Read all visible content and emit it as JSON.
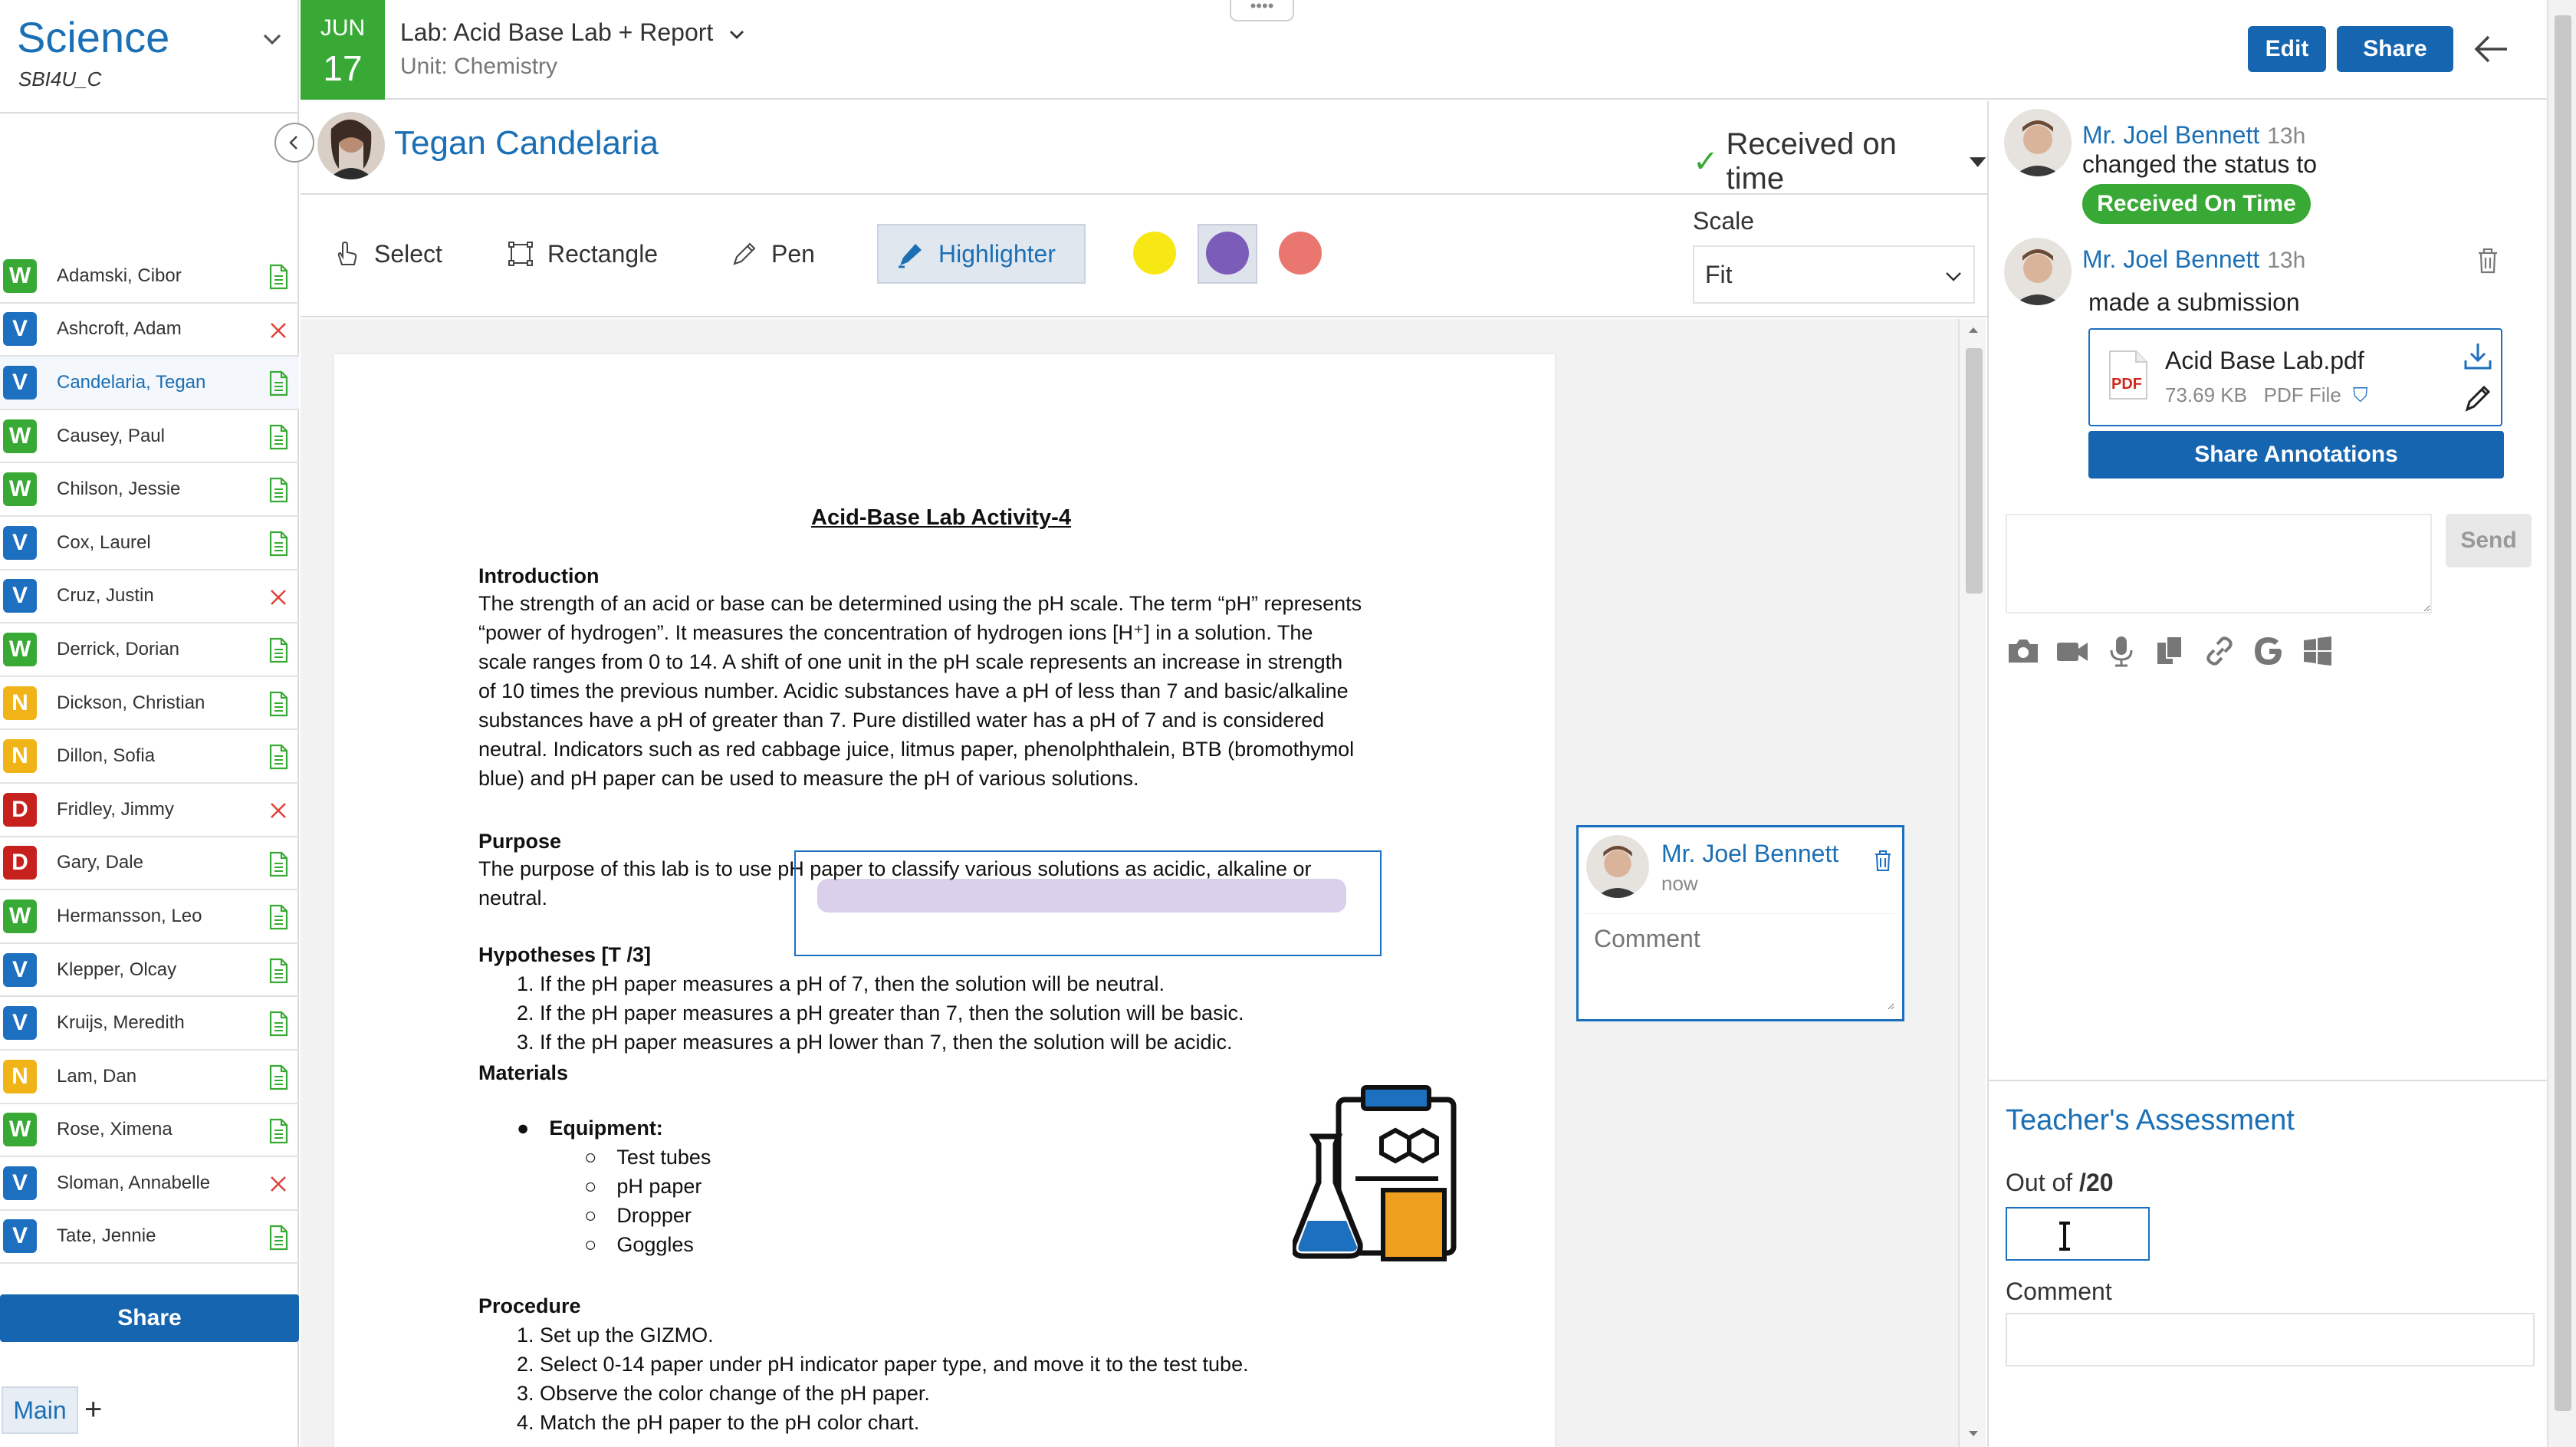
{
  "course": {
    "title": "Science",
    "code": "SBI4U_C"
  },
  "students": [
    {
      "badge": "W",
      "name": "Adamski, Cibor",
      "status": "submitted"
    },
    {
      "badge": "V",
      "name": "Ashcroft, Adam",
      "status": "missing"
    },
    {
      "badge": "V",
      "name": "Candelaria, Tegan",
      "status": "submitted",
      "active": true
    },
    {
      "badge": "W",
      "name": "Causey, Paul",
      "status": "submitted"
    },
    {
      "badge": "W",
      "name": "Chilson, Jessie",
      "status": "submitted"
    },
    {
      "badge": "V",
      "name": "Cox, Laurel",
      "status": "submitted"
    },
    {
      "badge": "V",
      "name": "Cruz, Justin",
      "status": "missing"
    },
    {
      "badge": "W",
      "name": "Derrick, Dorian",
      "status": "submitted"
    },
    {
      "badge": "N",
      "name": "Dickson, Christian",
      "status": "submitted"
    },
    {
      "badge": "N",
      "name": "Dillon, Sofia",
      "status": "submitted"
    },
    {
      "badge": "D",
      "name": "Fridley, Jimmy",
      "status": "missing"
    },
    {
      "badge": "D",
      "name": "Gary, Dale",
      "status": "submitted"
    },
    {
      "badge": "W",
      "name": "Hermansson, Leo",
      "status": "submitted"
    },
    {
      "badge": "V",
      "name": "Klepper, Olcay",
      "status": "submitted"
    },
    {
      "badge": "V",
      "name": "Kruijs, Meredith",
      "status": "submitted"
    },
    {
      "badge": "N",
      "name": "Lam, Dan",
      "status": "submitted"
    },
    {
      "badge": "W",
      "name": "Rose, Ximena",
      "status": "submitted"
    },
    {
      "badge": "V",
      "name": "Sloman, Annabelle",
      "status": "missing"
    },
    {
      "badge": "V",
      "name": "Tate, Jennie",
      "status": "submitted"
    }
  ],
  "sidebar": {
    "share_label": "Share",
    "tab_main": "Main",
    "tab_add": "+"
  },
  "header": {
    "month": "JUN",
    "day": "17",
    "assignment_title": "Lab: Acid Base Lab + Report",
    "unit": "Unit: Chemistry",
    "drag_handle": "••••",
    "edit_label": "Edit",
    "share_label": "Share"
  },
  "student_view": {
    "name": "Tegan Candelaria",
    "status": "Received on time"
  },
  "toolbar": {
    "select": "Select",
    "rectangle": "Rectangle",
    "pen": "Pen",
    "highlighter": "Highlighter",
    "scale_label": "Scale",
    "scale_value": "Fit",
    "colors": [
      "#f7e815",
      "#7b5cb8",
      "#ea7670"
    ]
  },
  "document": {
    "title": "Acid-Base Lab Activity-4",
    "intro_heading": "Introduction",
    "intro_lines": [
      "The strength of an acid or base can be determined using the pH scale. The term “pH” represents",
      "“power of hydrogen”. It measures the concentration of hydrogen ions [H⁺] in a solution. The",
      "scale ranges from 0 to 14. A shift of one unit in the pH scale represents an increase in strength",
      "of 10 times the previous number. Acidic substances have a pH of less than 7 and basic/alkaline",
      "substances have a pH of greater than 7. Pure distilled water has a pH of 7 and is considered",
      "neutral. Indicators such as red cabbage juice, litmus paper, phenolphthalein, BTB (bromothymol",
      "blue) and pH paper can be used to measure the pH of various solutions."
    ],
    "purpose_heading": "Purpose",
    "purpose_lines": [
      "The purpose of this lab is to use pH paper to classify various solutions as acidic, alkaline or",
      "neutral."
    ],
    "hypotheses_heading": "Hypotheses [T  /3]",
    "hypotheses": [
      "1.   If the pH paper measures a pH of 7, then the solution will be neutral.",
      "2.   If the pH paper measures a pH greater than 7, then the solution will be basic.",
      "3.   If the pH paper measures a pH lower than 7, then the solution will be acidic."
    ],
    "materials_heading": "Materials",
    "equipment_heading": "Equipment:",
    "equipment": [
      "Test tubes",
      "pH paper",
      "Dropper",
      "Goggles"
    ],
    "procedure_heading": "Procedure",
    "procedure": [
      "1.   Set up the GIZMO.",
      "2.   Select 0-14 paper under pH indicator paper type, and move it to the test tube.",
      "3.   Observe the color change of the pH paper.",
      "4.   Match the pH paper to the pH color chart."
    ]
  },
  "annotation": {
    "author": "Mr. Joel Bennett",
    "time": "now",
    "comment_placeholder": "Comment"
  },
  "feed": [
    {
      "author": "Mr. Joel Bennett",
      "time": "13h",
      "text": "changed the status to",
      "pill": "Received On Time"
    },
    {
      "author": "Mr. Joel Bennett",
      "time": "13h",
      "text": "made a submission"
    }
  ],
  "file": {
    "name": "Acid Base Lab.pdf",
    "size": "73.69 KB",
    "type": "PDF File",
    "icon_label": "PDF"
  },
  "share_annotations_label": "Share Annotations",
  "send_label": "Send",
  "assessment": {
    "title": "Teacher's Assessment",
    "out_of_label": "Out of",
    "out_of_value": "/20",
    "comment_label": "Comment"
  },
  "colors": {
    "primary": "#1565b0",
    "link": "#1a6fb5",
    "success": "#39a935",
    "danger": "#c7211d",
    "warning": "#f0b419"
  }
}
